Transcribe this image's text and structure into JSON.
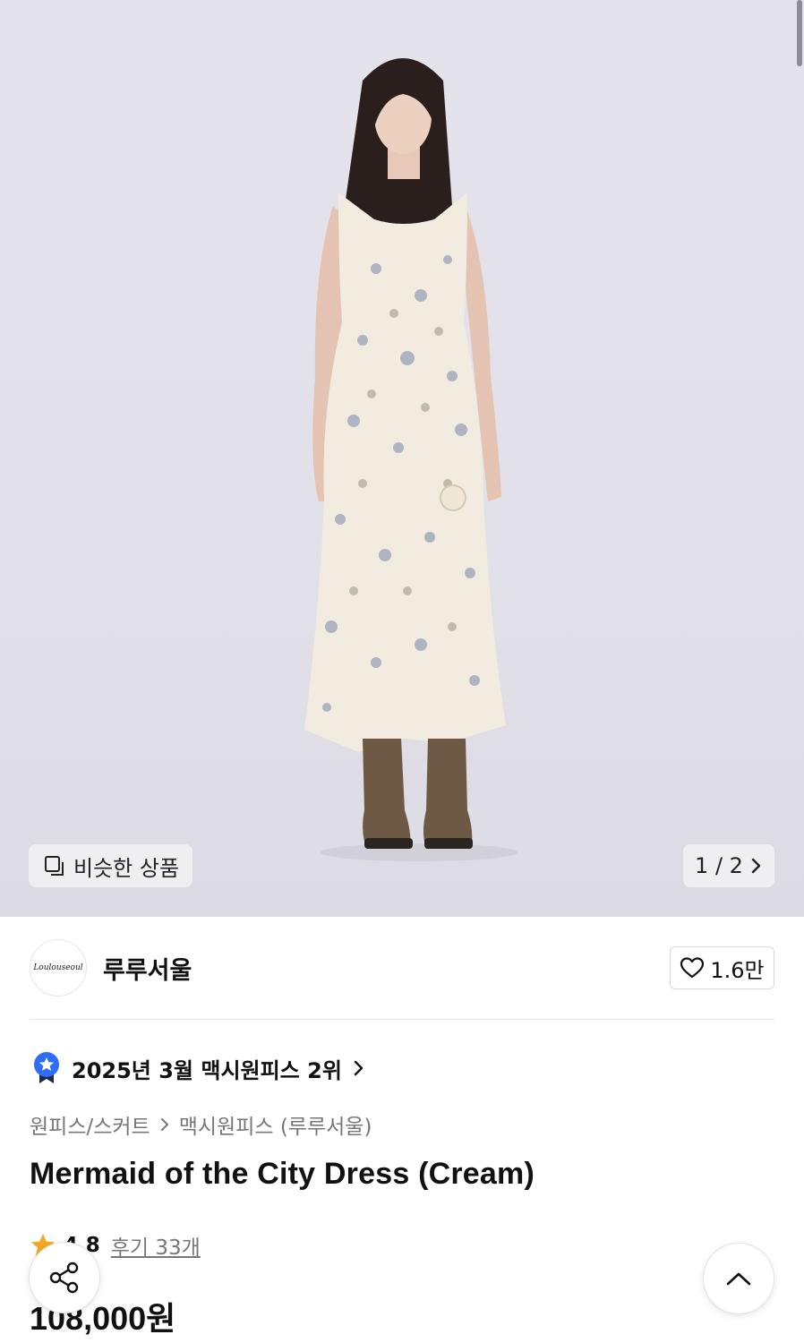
{
  "hero": {
    "similar_label": "비슷한 상품",
    "image_counter": "1 / 2"
  },
  "brand": {
    "logo_text": "Loulouseoul",
    "name": "루루서울",
    "likes": "1.6만"
  },
  "ranking": {
    "text": "2025년 3월 맥시원피스 2위"
  },
  "category": {
    "parent": "원피스/스커트",
    "child": "맥시원피스 (루루서울)"
  },
  "product": {
    "title": "Mermaid of the City Dress (Cream)",
    "rating": "4.8",
    "reviews": "후기 33개",
    "price": "108,000원"
  },
  "colors": {
    "accent_star": "#f5a623",
    "badge_blue": "#2f6df6",
    "text_primary": "#111111",
    "text_secondary": "#777777"
  },
  "icons": {
    "similar": "stacked-squares-icon",
    "next": "chevron-right-icon",
    "like": "heart-outline-icon",
    "rank": "ribbon-star-badge-icon",
    "share": "share-nodes-icon",
    "top": "chevron-up-icon"
  }
}
